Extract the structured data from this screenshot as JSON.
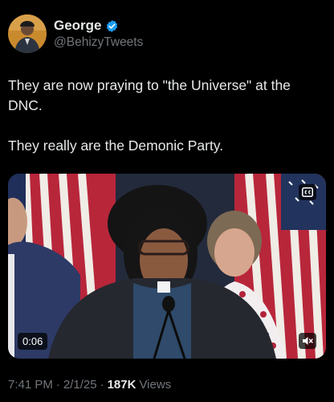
{
  "author": {
    "display_name": "George",
    "handle": "@BehizyTweets",
    "verified": true,
    "verified_color": "#1d9bf0"
  },
  "tweet": {
    "paragraphs": [
      "They are now praying to \"the Universe\" at the DNC.",
      "They really are the Demonic Party."
    ]
  },
  "media": {
    "type": "video",
    "duration": "0:06",
    "icons": [
      "closed-captions-icon",
      "mute-icon"
    ]
  },
  "meta": {
    "time": "7:41 PM",
    "date": "2/1/25",
    "separator": "·",
    "views_count": "187K",
    "views_label": "Views"
  }
}
